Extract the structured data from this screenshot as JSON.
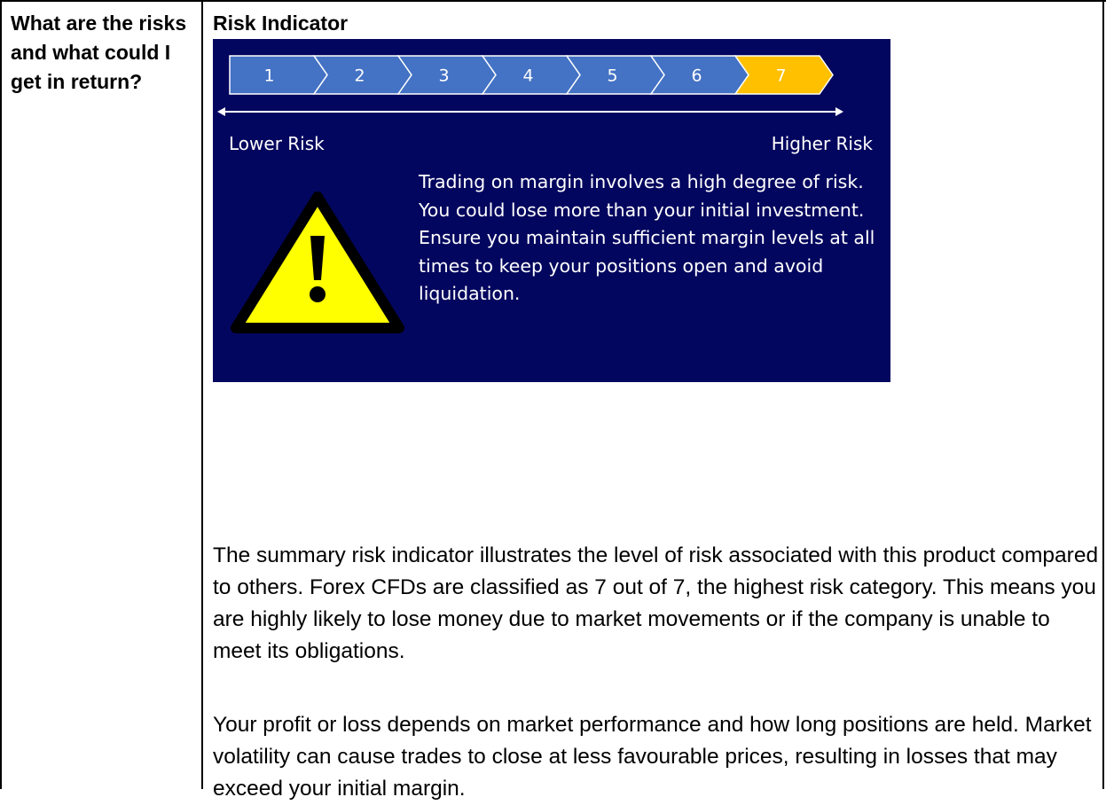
{
  "section": {
    "question": "What are the risks and what could I get in return?",
    "heading": "Risk Indicator"
  },
  "risk_indicator": {
    "levels": [
      "1",
      "2",
      "3",
      "4",
      "5",
      "6",
      "7"
    ],
    "selected_level": 7,
    "lower_label": "Lower Risk",
    "higher_label": "Higher Risk",
    "warning_text": "Trading on margin involves a high degree of risk. You could lose more than your initial investment. Ensure you maintain sufficient margin levels at all times to keep your positions open and avoid liquidation.",
    "colors": {
      "panel": "#03065e",
      "level": "#4472c4",
      "selected": "#ffc000",
      "warning": "#ffff00"
    },
    "icon": "warning-triangle-icon"
  },
  "body": {
    "paragraph_1": "The summary risk indicator illustrates the level of risk associated with this product compared to others. Forex CFDs are classified as 7 out of 7, the highest risk category. This means you are highly likely to lose money due to market movements or if the company is unable to meet its obligations.",
    "paragraph_2": "Your profit or loss depends on market performance and how long positions are held. Market volatility can cause trades to close at less favourable prices, resulting in losses that may exceed your initial margin."
  }
}
